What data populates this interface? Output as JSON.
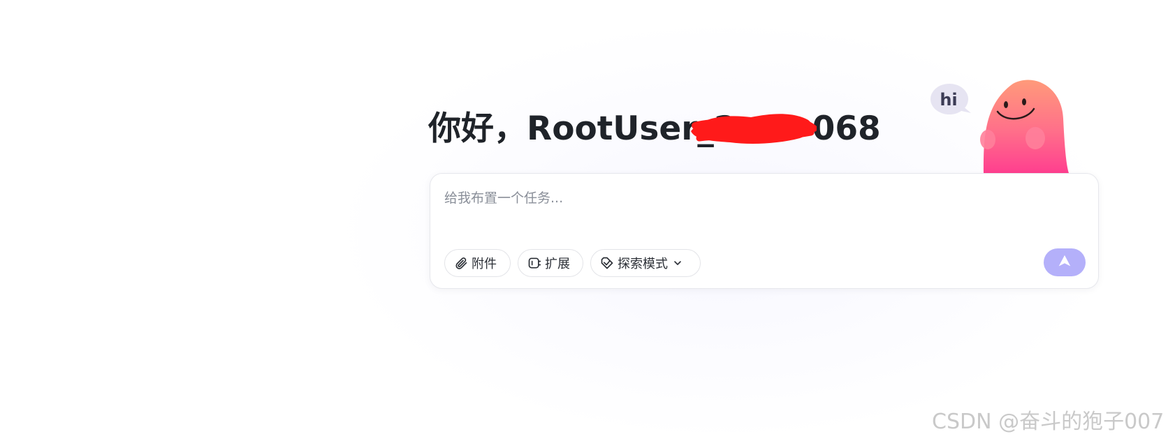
{
  "greeting": {
    "hello": "你好，",
    "username": "RootUser_2",
    "username_tail": "068"
  },
  "mascot": {
    "speech": "hi"
  },
  "input": {
    "placeholder": "给我布置一个任务..."
  },
  "toolbar": {
    "attach_label": "附件",
    "extend_label": "扩展",
    "mode_label": "探索模式"
  },
  "icons": {
    "attach": "paperclip-icon",
    "extend": "plugin-icon",
    "mode": "tag-icon",
    "chevron": "chevron-down-icon",
    "send": "send-arrow-icon"
  },
  "colors": {
    "send_button": "#b4b0fa",
    "title": "#1f2329",
    "redaction": "#ff1a1a"
  },
  "watermark": {
    "text": "CSDN @奋斗的狍子007"
  }
}
